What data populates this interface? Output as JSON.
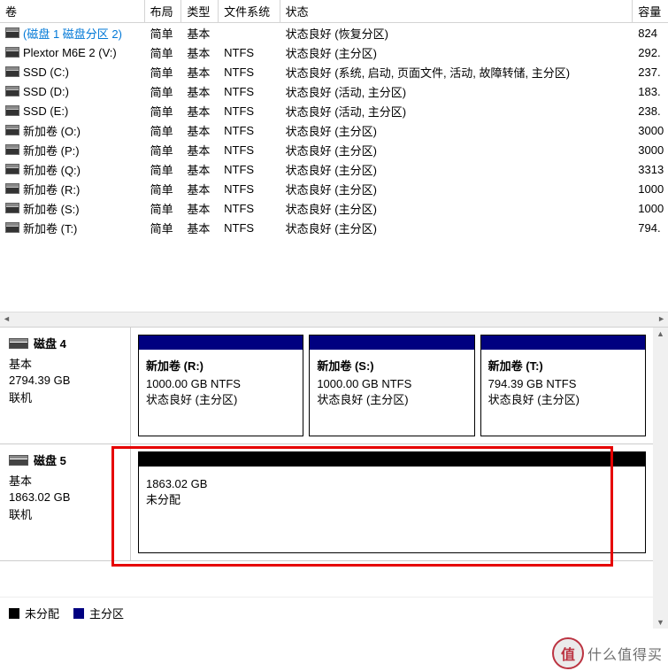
{
  "columns": {
    "volume": "卷",
    "layout": "布局",
    "type": "类型",
    "filesystem": "文件系统",
    "status": "状态",
    "capacity": "容量"
  },
  "volumes": [
    {
      "name": "(磁盘 1 磁盘分区 2)",
      "layout": "简单",
      "type": "基本",
      "fs": "",
      "status": "状态良好 (恢复分区)",
      "cap": "824",
      "selected": true
    },
    {
      "name": "Plextor M6E 2 (V:)",
      "layout": "简单",
      "type": "基本",
      "fs": "NTFS",
      "status": "状态良好 (主分区)",
      "cap": "292.",
      "selected": false
    },
    {
      "name": "SSD (C:)",
      "layout": "简单",
      "type": "基本",
      "fs": "NTFS",
      "status": "状态良好 (系统, 启动, 页面文件, 活动, 故障转储, 主分区)",
      "cap": "237.",
      "selected": false
    },
    {
      "name": "SSD (D:)",
      "layout": "简单",
      "type": "基本",
      "fs": "NTFS",
      "status": "状态良好 (活动, 主分区)",
      "cap": "183.",
      "selected": false
    },
    {
      "name": "SSD (E:)",
      "layout": "简单",
      "type": "基本",
      "fs": "NTFS",
      "status": "状态良好 (活动, 主分区)",
      "cap": "238.",
      "selected": false
    },
    {
      "name": "新加卷 (O:)",
      "layout": "简单",
      "type": "基本",
      "fs": "NTFS",
      "status": "状态良好 (主分区)",
      "cap": "3000",
      "selected": false
    },
    {
      "name": "新加卷 (P:)",
      "layout": "简单",
      "type": "基本",
      "fs": "NTFS",
      "status": "状态良好 (主分区)",
      "cap": "3000",
      "selected": false
    },
    {
      "name": "新加卷 (Q:)",
      "layout": "简单",
      "type": "基本",
      "fs": "NTFS",
      "status": "状态良好 (主分区)",
      "cap": "3313",
      "selected": false
    },
    {
      "name": "新加卷 (R:)",
      "layout": "简单",
      "type": "基本",
      "fs": "NTFS",
      "status": "状态良好 (主分区)",
      "cap": "1000",
      "selected": false
    },
    {
      "name": "新加卷 (S:)",
      "layout": "简单",
      "type": "基本",
      "fs": "NTFS",
      "status": "状态良好 (主分区)",
      "cap": "1000",
      "selected": false
    },
    {
      "name": "新加卷 (T:)",
      "layout": "简单",
      "type": "基本",
      "fs": "NTFS",
      "status": "状态良好 (主分区)",
      "cap": "794.",
      "selected": false
    }
  ],
  "disk4": {
    "name": "磁盘 4",
    "type": "基本",
    "size": "2794.39 GB",
    "online": "联机",
    "parts": [
      {
        "label": "新加卷  (R:)",
        "size": "1000.00 GB NTFS",
        "status": "状态良好 (主分区)"
      },
      {
        "label": "新加卷  (S:)",
        "size": "1000.00 GB NTFS",
        "status": "状态良好 (主分区)"
      },
      {
        "label": "新加卷  (T:)",
        "size": "794.39 GB NTFS",
        "status": "状态良好 (主分区)"
      }
    ]
  },
  "disk5": {
    "name": "磁盘 5",
    "type": "基本",
    "size": "1863.02 GB",
    "online": "联机",
    "part": {
      "size": "1863.02 GB",
      "status": "未分配"
    }
  },
  "legend": {
    "unallocated": "未分配",
    "primary": "主分区"
  },
  "watermark": {
    "glyph": "值",
    "text": "什么值得买"
  }
}
